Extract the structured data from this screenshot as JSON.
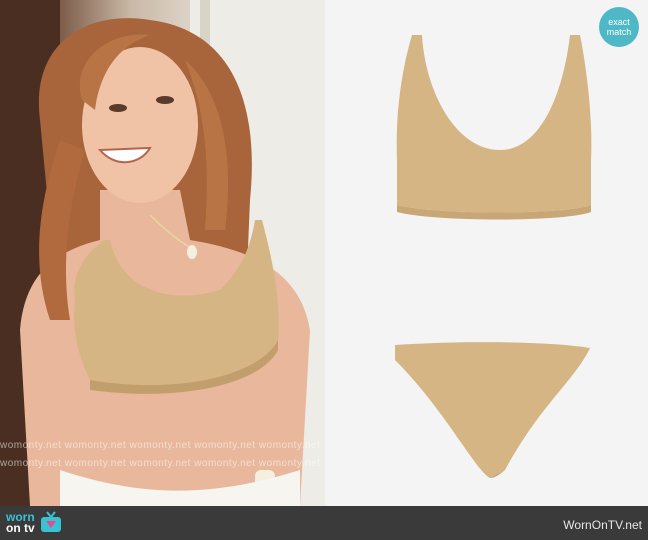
{
  "badge": {
    "label_line1": "exact",
    "label_line2": "match"
  },
  "watermark": {
    "text": "womonty.net  womonty.net  womonty.net  womonty.net  womonty.net"
  },
  "footer": {
    "logo_line1": "worn",
    "logo_line2": "on tv",
    "site_url": "WornOnTV.net"
  },
  "colors": {
    "swimsuit": "#d6b585",
    "badge": "#4fb8c6",
    "footer": "#3a3a3a",
    "logo_accent": "#39c1d4"
  }
}
